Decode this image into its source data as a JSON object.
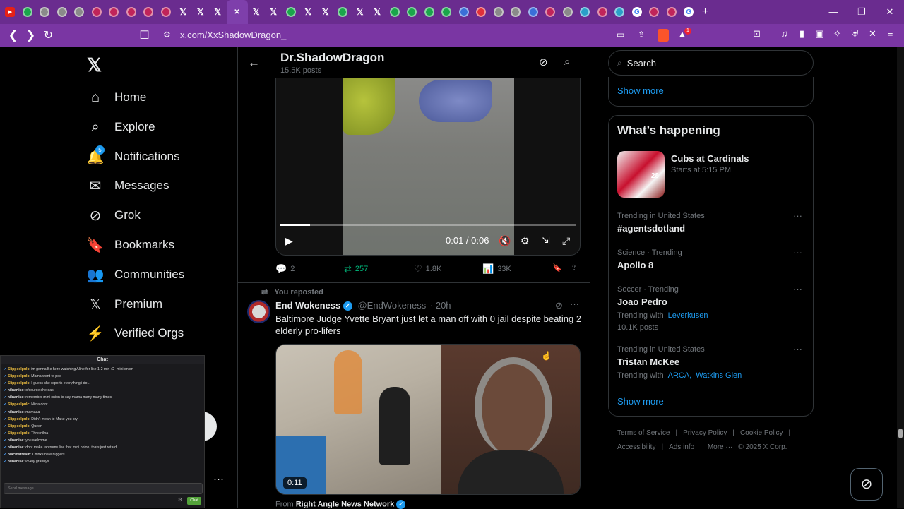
{
  "browser": {
    "tabs": [
      {
        "icon": "youtube",
        "color": "#e62117"
      },
      {
        "icon": "circle",
        "color": "#1aa64b"
      },
      {
        "icon": "circle",
        "color": "#8a8a8a"
      },
      {
        "icon": "circle",
        "color": "#8a8a8a"
      },
      {
        "icon": "circle",
        "color": "#8a8a8a"
      },
      {
        "icon": "circle",
        "color": "#c0245a"
      },
      {
        "icon": "circle",
        "color": "#c0245a"
      },
      {
        "icon": "circle",
        "color": "#c0245a"
      },
      {
        "icon": "circle",
        "color": "#c0245a"
      },
      {
        "icon": "circle",
        "color": "#c0245a"
      },
      {
        "icon": "x",
        "color": "#000000"
      },
      {
        "icon": "x",
        "color": "#000000"
      },
      {
        "icon": "x",
        "color": "#000000"
      },
      {
        "icon": "close",
        "color": "#7e3fab"
      },
      {
        "icon": "x",
        "color": "#000000"
      },
      {
        "icon": "x",
        "color": "#000000"
      },
      {
        "icon": "circle",
        "color": "#1aa64b"
      },
      {
        "icon": "x",
        "color": "#000000"
      },
      {
        "icon": "x",
        "color": "#000000"
      },
      {
        "icon": "circle",
        "color": "#1aa64b"
      },
      {
        "icon": "x",
        "color": "#000000"
      },
      {
        "icon": "x",
        "color": "#000000"
      },
      {
        "icon": "circle",
        "color": "#1aa64b"
      },
      {
        "icon": "circle",
        "color": "#1aa64b"
      },
      {
        "icon": "circle",
        "color": "#1aa64b"
      },
      {
        "icon": "circle",
        "color": "#1aa64b"
      },
      {
        "icon": "circle",
        "color": "#3a6fd8"
      },
      {
        "icon": "circle",
        "color": "#e0303a"
      },
      {
        "icon": "circle",
        "color": "#8a8a8a"
      },
      {
        "icon": "circle",
        "color": "#8a8a8a"
      },
      {
        "icon": "circle",
        "color": "#3a6fd8"
      },
      {
        "icon": "circle",
        "color": "#c0245a"
      },
      {
        "icon": "circle",
        "color": "#8a8a8a"
      },
      {
        "icon": "circle",
        "color": "#2aa0c8"
      },
      {
        "icon": "circle",
        "color": "#c0245a"
      },
      {
        "icon": "circle",
        "color": "#2aa0c8"
      },
      {
        "icon": "google",
        "color": "#ffffff"
      },
      {
        "icon": "circle",
        "color": "#c0245a"
      },
      {
        "icon": "circle",
        "color": "#c0245a"
      },
      {
        "icon": "google",
        "color": "#ffffff"
      }
    ],
    "url": "x.com/XxShadowDragon_",
    "brave_badge": "1"
  },
  "nav": {
    "items": [
      {
        "label": "Home",
        "icon": "home-icon",
        "glyph": "⌂"
      },
      {
        "label": "Explore",
        "icon": "search-icon",
        "glyph": "⌕"
      },
      {
        "label": "Notifications",
        "icon": "bell-icon",
        "glyph": "🔔"
      },
      {
        "label": "Messages",
        "icon": "envelope-icon",
        "glyph": "✉"
      },
      {
        "label": "Grok",
        "icon": "grok-icon",
        "glyph": "⊘"
      },
      {
        "label": "Bookmarks",
        "icon": "bookmark-icon",
        "glyph": "🔖"
      },
      {
        "label": "Communities",
        "icon": "communities-icon",
        "glyph": "👥"
      },
      {
        "label": "Premium",
        "icon": "x-logo-icon",
        "glyph": "𝕏"
      },
      {
        "label": "Verified Orgs",
        "icon": "lightning-icon",
        "glyph": "⚡"
      }
    ],
    "notification_count": "5"
  },
  "profile": {
    "name": "Dr.ShadowDragon",
    "posts": "15.5K posts"
  },
  "video1": {
    "time": "0:01 / 0:06",
    "progress": 0.1
  },
  "tweet1_actions": {
    "replies": "2",
    "reposts": "257",
    "likes": "1.8K",
    "views": "33K"
  },
  "tweet2": {
    "repost_label": "You reposted",
    "name": "End Wokeness",
    "handle": "@EndWokeness",
    "time": "· 20h",
    "text": "Baltimore Judge Yvette Bryant just let a man off with 0 jail despite beating 2 elderly pro-lifers",
    "duration": "0:11",
    "from_prefix": "From",
    "from_name": "Right Angle News Network"
  },
  "right": {
    "search_placeholder": "Search",
    "show_more": "Show more",
    "whats_happening": "What’s happening",
    "event": {
      "title": "Cubs at Cardinals",
      "sub": "Starts at 5:15 PM",
      "jersey": "28"
    },
    "trends": [
      {
        "meta": "Trending in United States",
        "name": "#agentsdotland",
        "sub_prefix": "",
        "links": [],
        "count": ""
      },
      {
        "meta": "Science · Trending",
        "name": "Apollo 8",
        "sub_prefix": "",
        "links": [],
        "count": ""
      },
      {
        "meta": "Soccer · Trending",
        "name": "Joao Pedro",
        "sub_prefix": "Trending with",
        "links": [
          "Leverkusen"
        ],
        "count": "10.1K posts"
      },
      {
        "meta": "Trending in United States",
        "name": "Tristan McKee",
        "sub_prefix": "Trending with",
        "links": [
          "ARCA,",
          "Watkins Glen"
        ],
        "count": ""
      }
    ],
    "show_more_2": "Show more",
    "footer1": [
      "Terms of Service",
      "|",
      "Privacy Policy",
      "|",
      "Cookie Policy",
      "|"
    ],
    "footer2": [
      "Accessibility",
      "|",
      "Ads info",
      "|",
      "More ···",
      "© 2025 X Corp."
    ]
  },
  "chat": {
    "title": "Chat",
    "messages": [
      {
        "user": "Slippeslpulc",
        "text": "im gonna Be here watching Aline for like 1-2 min :D -mini onion",
        "gold": true
      },
      {
        "user": "Slippeslpulc",
        "text": "Mama went to pee",
        "gold": true
      },
      {
        "user": "Slippeslpulc",
        "text": "I guess she reports everything i do...",
        "gold": true
      },
      {
        "user": "nilnanise",
        "text": "ofcourse she das",
        "gold": false
      },
      {
        "user": "nilnanise",
        "text": "remember mini onion to say mama many many times",
        "gold": false
      },
      {
        "user": "Slippeslpulc",
        "text": "Niina dont",
        "gold": true
      },
      {
        "user": "nilnanise",
        "text": "mamaaa",
        "gold": false
      },
      {
        "user": "Slippeslpulc",
        "text": "Didn't mean to Make you cry",
        "gold": true
      },
      {
        "user": "Slippeslpulc",
        "text": "Queen",
        "gold": true
      },
      {
        "user": "Slippeslpulc",
        "text": "Thnx nilna",
        "gold": true
      },
      {
        "user": "nilnanise",
        "text": "you welcome",
        "gold": false
      },
      {
        "user": "nilnanise",
        "text": "dont make tantrums like that mini onion, thats just retard",
        "gold": false
      },
      {
        "user": "placidstream",
        "text": "Chinks hate niggers",
        "gold": false
      },
      {
        "user": "nilnanise",
        "text": "lovely grannys",
        "gold": false
      }
    ],
    "input_placeholder": "Send message...",
    "send_label": "Chat"
  }
}
